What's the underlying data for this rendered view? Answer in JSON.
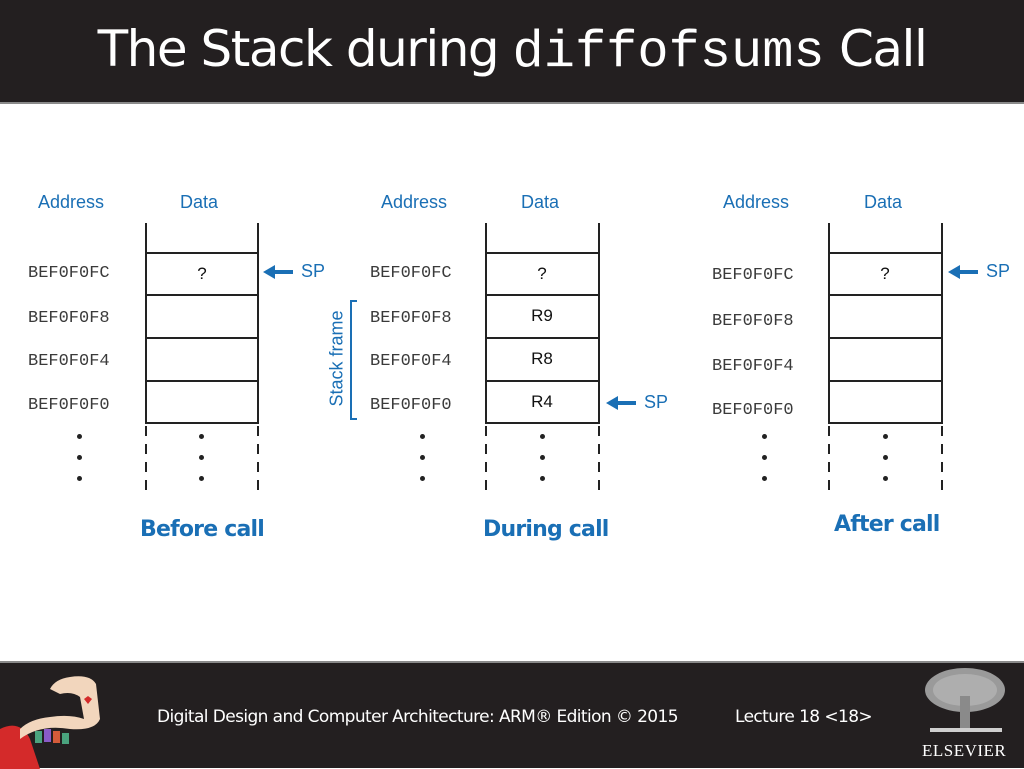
{
  "header": {
    "title_prefix": "The Stack during ",
    "title_code": "diffofsums",
    "title_suffix": " Call"
  },
  "diagrams": [
    {
      "caption": "Before call",
      "address_label": "Address",
      "data_label": "Data",
      "rows": [
        {
          "address": "BEF0F0FC",
          "data": "?"
        },
        {
          "address": "BEF0F0F8",
          "data": ""
        },
        {
          "address": "BEF0F0F4",
          "data": ""
        },
        {
          "address": "BEF0F0F0",
          "data": ""
        }
      ],
      "sp_label": "SP",
      "sp_row": 0
    },
    {
      "caption": "During call",
      "address_label": "Address",
      "data_label": "Data",
      "rows": [
        {
          "address": "BEF0F0FC",
          "data": "?"
        },
        {
          "address": "BEF0F0F8",
          "data": "R9"
        },
        {
          "address": "BEF0F0F4",
          "data": "R8"
        },
        {
          "address": "BEF0F0F0",
          "data": "R4"
        }
      ],
      "sp_label": "SP",
      "sp_row": 3,
      "stack_frame_label": "Stack frame"
    },
    {
      "caption": "After call",
      "address_label": "Address",
      "data_label": "Data",
      "rows": [
        {
          "address": "BEF0F0FC",
          "data": "?"
        },
        {
          "address": "BEF0F0F8",
          "data": ""
        },
        {
          "address": "BEF0F0F4",
          "data": ""
        },
        {
          "address": "BEF0F0F0",
          "data": ""
        }
      ],
      "sp_label": "SP",
      "sp_row": 0
    }
  ],
  "footer": {
    "book": "Digital Design and Computer Architecture: ARM® Edition © 2015",
    "lecture": "Lecture 18 <18>",
    "publisher": "ELSEVIER"
  },
  "colors": {
    "accent": "#1a6fb5",
    "bar": "#231f20"
  }
}
